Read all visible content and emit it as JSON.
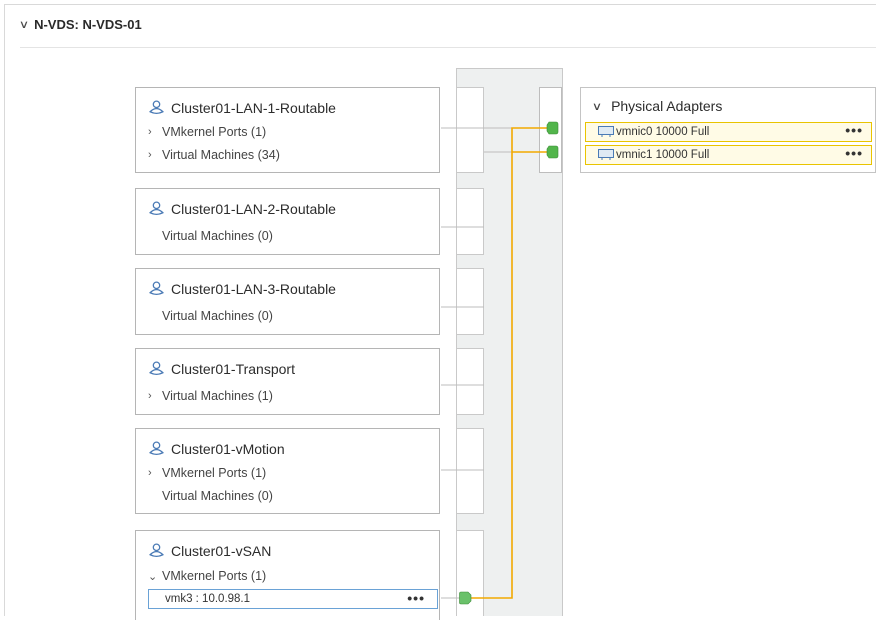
{
  "header": {
    "title": "N-VDS: N-VDS-01"
  },
  "portgroups": [
    {
      "name": "Cluster01-LAN-1-Routable",
      "rows": [
        {
          "label": "VMkernel Ports (1)",
          "chevron": "right"
        },
        {
          "label": "Virtual Machines (34)",
          "chevron": "right"
        }
      ]
    },
    {
      "name": "Cluster01-LAN-2-Routable",
      "rows": [
        {
          "label": "Virtual Machines (0)",
          "chevron": "none"
        }
      ]
    },
    {
      "name": "Cluster01-LAN-3-Routable",
      "rows": [
        {
          "label": "Virtual Machines (0)",
          "chevron": "none"
        }
      ]
    },
    {
      "name": "Cluster01-Transport",
      "rows": [
        {
          "label": "Virtual Machines (1)",
          "chevron": "right"
        }
      ]
    },
    {
      "name": "Cluster01-vMotion",
      "rows": [
        {
          "label": "VMkernel Ports (1)",
          "chevron": "right"
        },
        {
          "label": "Virtual Machines (0)",
          "chevron": "none"
        }
      ]
    },
    {
      "name": "Cluster01-vSAN",
      "rows": [
        {
          "label": "VMkernel Ports (1)",
          "chevron": "down"
        }
      ],
      "vmk": "vmk3 : 10.0.98.1"
    }
  ],
  "physical_adapters": {
    "title": "Physical Adapters",
    "items": [
      {
        "label": "vmnic0 10000 Full"
      },
      {
        "label": "vmnic1 10000 Full"
      }
    ]
  },
  "icons": {
    "portgroup": "portgroup-icon",
    "nic": "network-card-icon",
    "more": "more-icon"
  },
  "colors": {
    "active_link": "#f2a900",
    "link": "#bdbdbd",
    "port": "#52b54b",
    "highlight_border": "#e9c400",
    "highlight_bg": "#fffbe6"
  }
}
